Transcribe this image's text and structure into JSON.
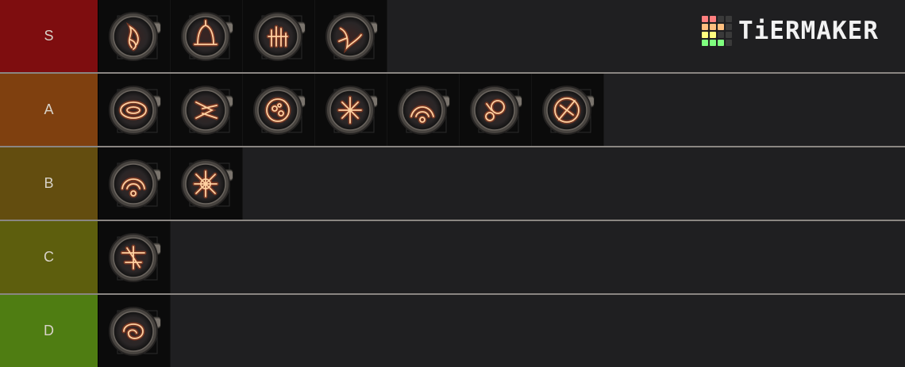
{
  "brand": {
    "name": "TiERMAKER",
    "grid_colors": [
      "#ff7f7f",
      "#ff7f7f",
      "#3a3a3a",
      "#3a3a3a",
      "#ffbf7f",
      "#ffbf7f",
      "#ffbf7f",
      "#3a3a3a",
      "#ffff7f",
      "#ffff7f",
      "#3a3a3a",
      "#3a3a3a",
      "#7fff7f",
      "#7fff7f",
      "#7fff7f",
      "#3a3a3a"
    ]
  },
  "tiers": [
    {
      "label": "S",
      "color": "#7e0d0f",
      "items": [
        "flame-rune-1",
        "bell-rune",
        "hand-rune",
        "bird-rune"
      ]
    },
    {
      "label": "A",
      "color": "#7f400f",
      "items": [
        "ring-rune",
        "arrow-rune",
        "burst-rune",
        "star-rune",
        "wave-rune",
        "orb-rune",
        "cross-rune"
      ]
    },
    {
      "label": "B",
      "color": "#634d0f",
      "items": [
        "arc-rune",
        "spark-rune"
      ]
    },
    {
      "label": "C",
      "color": "#5d5e0d",
      "items": [
        "shield-rune"
      ]
    },
    {
      "label": "D",
      "color": "#4f7d12",
      "items": [
        "swirl-rune"
      ]
    }
  ]
}
